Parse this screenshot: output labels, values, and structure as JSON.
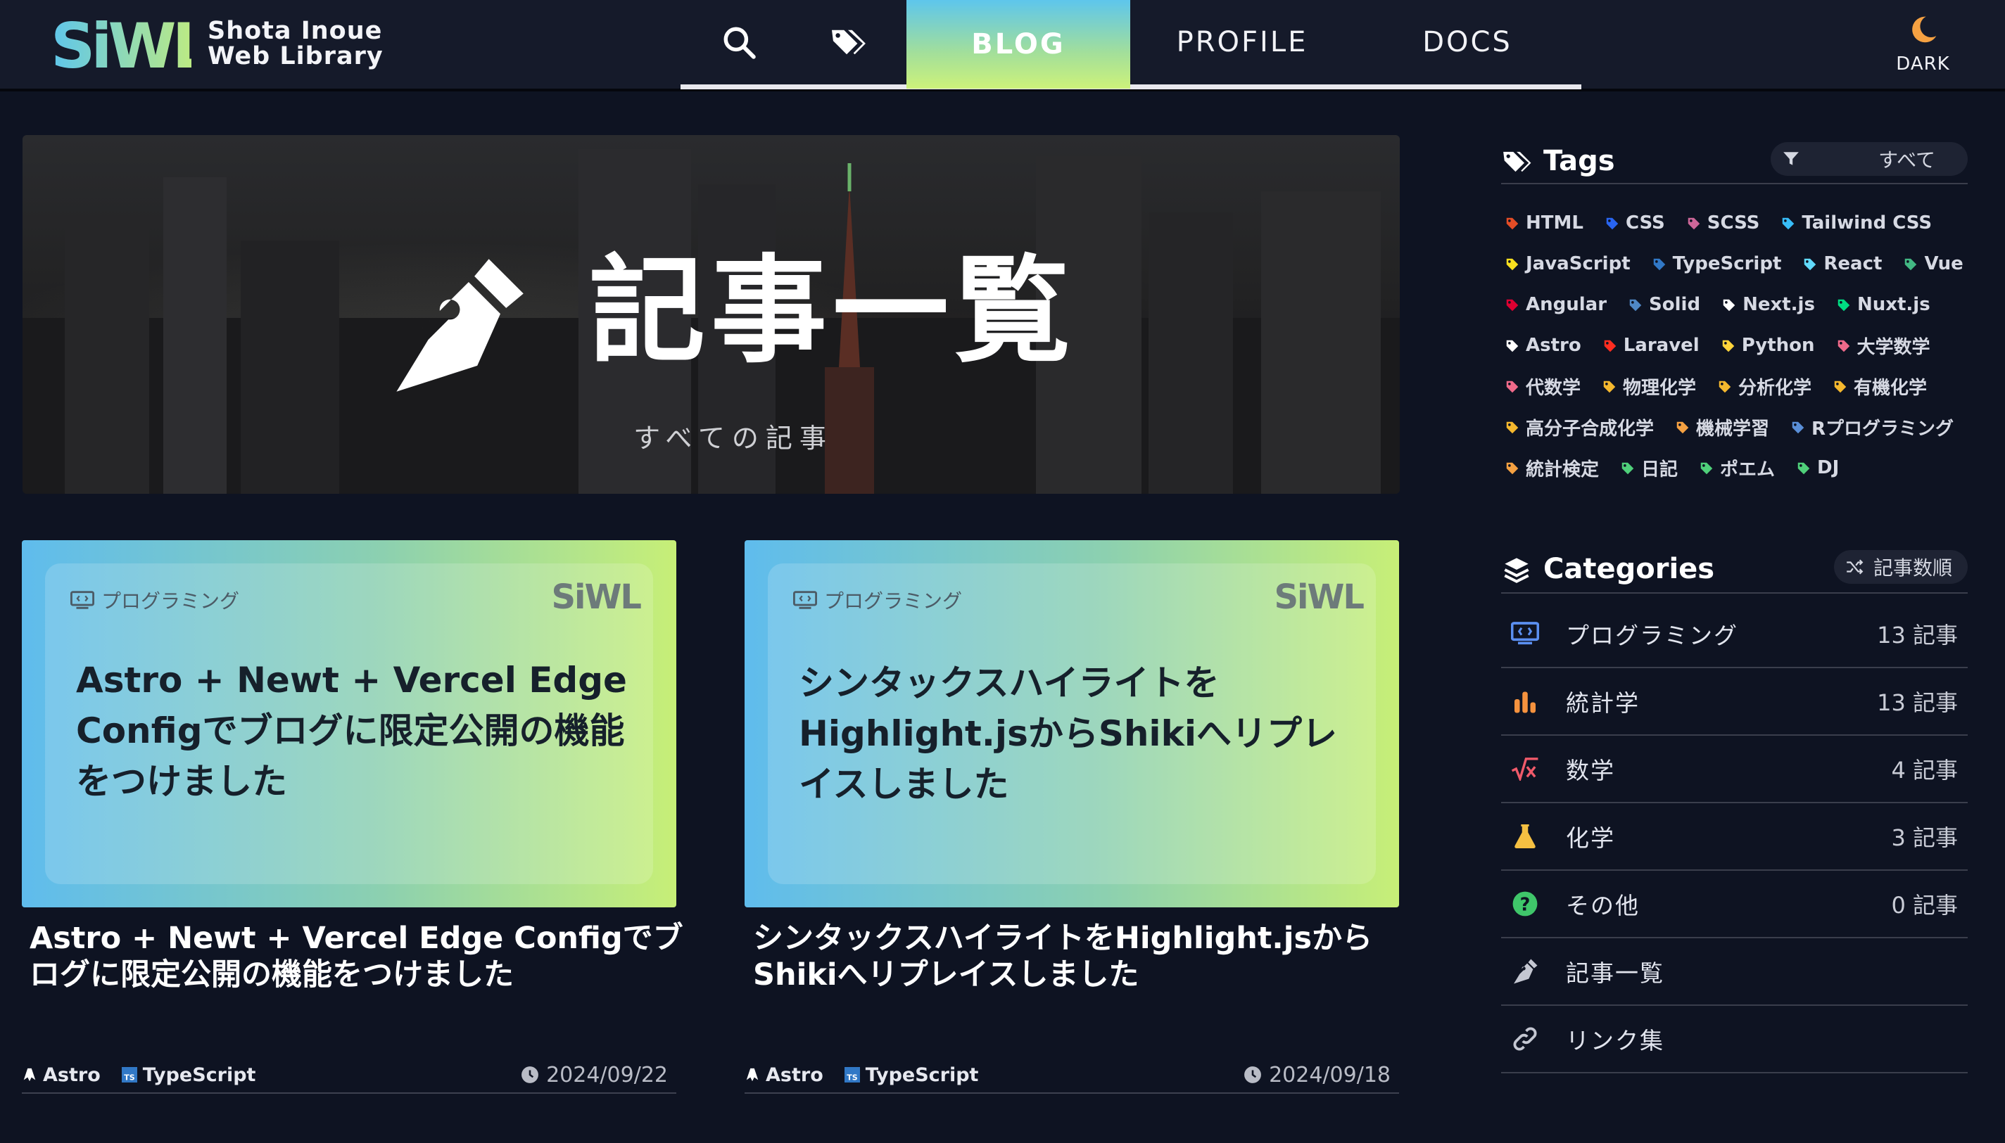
{
  "header": {
    "logo_text": "SiWL",
    "site_title_line1": "Shota Inoue",
    "site_title_line2": "Web Library",
    "nav": {
      "blog": "BLOG",
      "profile": "PROFILE",
      "docs": "DOCS"
    },
    "dark_toggle_label": "DARK"
  },
  "hero": {
    "title": "記事一覧",
    "subtitle": "すべての記事"
  },
  "cards": [
    {
      "category": "プログラミング",
      "thumb_logo": "SiWL",
      "thumb_title": "Astro + Newt + Vercel Edge Configでブログに限定公開の機能をつけました",
      "title": "Astro + Newt + Vercel Edge Configでブログに限定公開の機能をつけました",
      "tags": [
        "Astro",
        "TypeScript"
      ],
      "date": "2024/09/22"
    },
    {
      "category": "プログラミング",
      "thumb_logo": "SiWL",
      "thumb_title": "シンタックスハイライトをHighlight.jsからShikiへリプレイスしました",
      "title": "シンタックスハイライトをHighlight.jsからShikiへリプレイスしました",
      "tags": [
        "Astro",
        "TypeScript"
      ],
      "date": "2024/09/18"
    }
  ],
  "sidebar": {
    "tags_title": "Tags",
    "tags_filter": "すべて",
    "tags": [
      {
        "label": "HTML",
        "color": "#e44d26"
      },
      {
        "label": "CSS",
        "color": "#2965f1"
      },
      {
        "label": "SCSS",
        "color": "#cd6799"
      },
      {
        "label": "Tailwind CSS",
        "color": "#38bdf8"
      },
      {
        "label": "JavaScript",
        "color": "#f7df1e"
      },
      {
        "label": "TypeScript",
        "color": "#3178c6"
      },
      {
        "label": "React",
        "color": "#61dafb"
      },
      {
        "label": "Vue",
        "color": "#42b883"
      },
      {
        "label": "Angular",
        "color": "#dd0031"
      },
      {
        "label": "Solid",
        "color": "#4f88c6"
      },
      {
        "label": "Next.js",
        "color": "#ffffff"
      },
      {
        "label": "Nuxt.js",
        "color": "#00dc82"
      },
      {
        "label": "Astro",
        "color": "#ffffff"
      },
      {
        "label": "Laravel",
        "color": "#ff2d20"
      },
      {
        "label": "Python",
        "color": "#ffd43b"
      },
      {
        "label": "大学数学",
        "color": "#f06a8a"
      },
      {
        "label": "代数学",
        "color": "#f06a8a"
      },
      {
        "label": "物理化学",
        "color": "#f5b82e"
      },
      {
        "label": "分析化学",
        "color": "#f5b82e"
      },
      {
        "label": "有機化学",
        "color": "#f5b82e"
      },
      {
        "label": "高分子合成化学",
        "color": "#f5b82e"
      },
      {
        "label": "機械学習",
        "color": "#f5a142"
      },
      {
        "label": "Rプログラミング",
        "color": "#5a8fd8"
      },
      {
        "label": "統計検定",
        "color": "#f5a142"
      },
      {
        "label": "日記",
        "color": "#4fd07a"
      },
      {
        "label": "ポエム",
        "color": "#4fd07a"
      },
      {
        "label": "DJ",
        "color": "#4fd07a"
      }
    ],
    "categories_title": "Categories",
    "categories_sort": "記事数順",
    "categories": [
      {
        "name": "プログラミング",
        "count": "13 記事",
        "icon": "code-icon",
        "color": "#5b8ff0"
      },
      {
        "name": "統計学",
        "count": "13 記事",
        "icon": "bar-chart-icon",
        "color": "#f5923e"
      },
      {
        "name": "数学",
        "count": "4 記事",
        "icon": "sqrt-icon",
        "color": "#f05a6a"
      },
      {
        "name": "化学",
        "count": "3 記事",
        "icon": "flask-icon",
        "color": "#f5c042"
      },
      {
        "name": "その他",
        "count": "0 記事",
        "icon": "question-icon",
        "color": "#3fc66a"
      },
      {
        "name": "記事一覧",
        "count": "",
        "icon": "pen-icon",
        "color": "#c4c7d2"
      },
      {
        "name": "リンク集",
        "count": "",
        "icon": "link-icon",
        "color": "#c4c7d2"
      }
    ]
  }
}
